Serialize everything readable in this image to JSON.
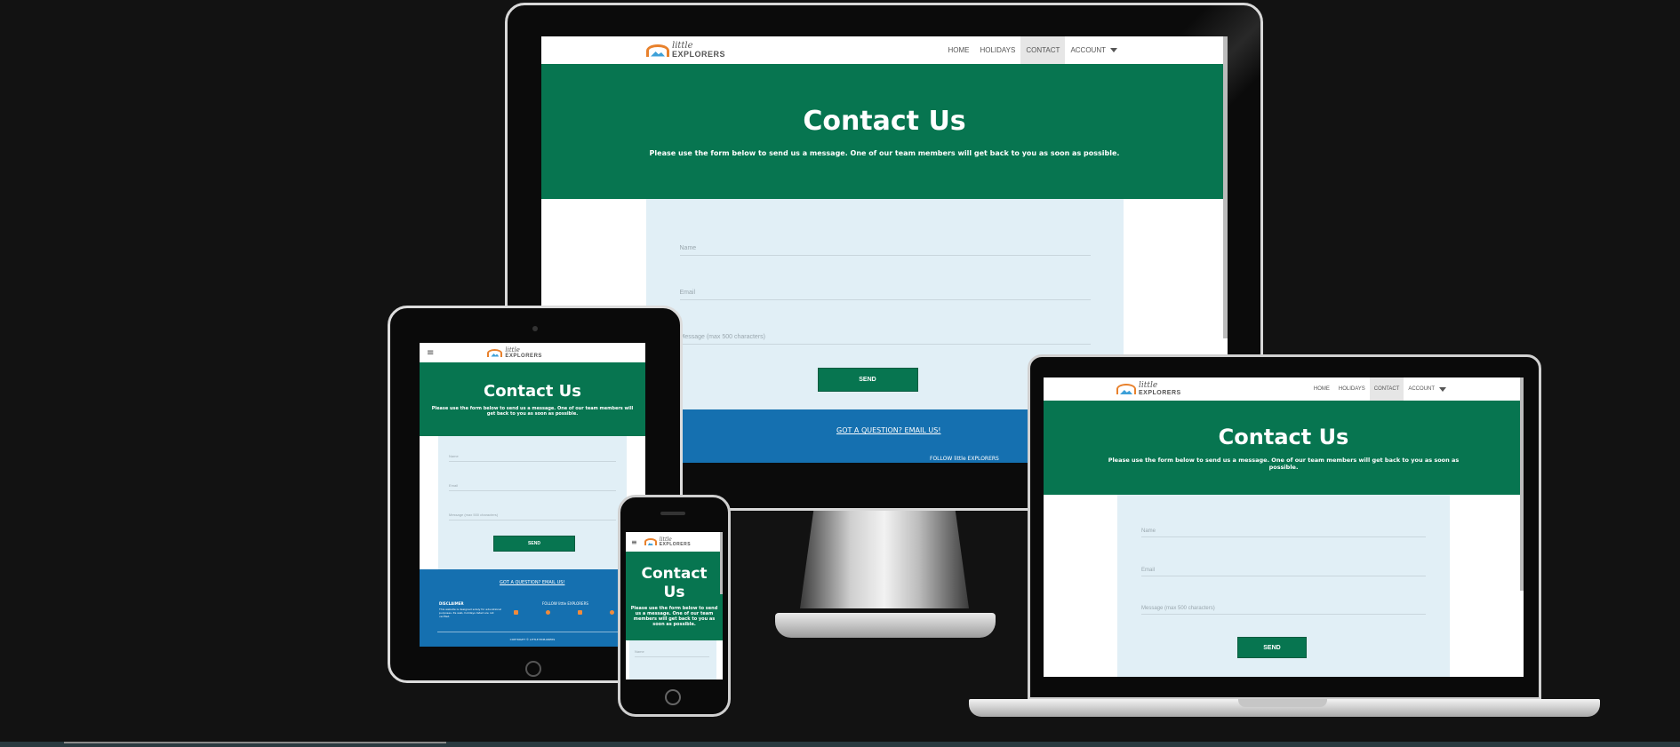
{
  "site": {
    "logo_top": "little",
    "logo_bottom": "EXPLORERS",
    "nav": {
      "home": "HOME",
      "holidays": "HOLIDAYS",
      "contact": "CONTACT",
      "account": "ACCOUNT"
    },
    "menu_glyph": "≡",
    "hero_title": "Contact Us",
    "hero_text": "Please use the form below to send us a message. One of our team members will get back to you as soon as possible.",
    "form": {
      "name_placeholder": "Name",
      "email_placeholder": "Email",
      "message_placeholder": "Message (max 500 characters)",
      "send_label": "SEND"
    },
    "footer": {
      "email_link": "GOT A QUESTION? EMAIL US!",
      "follow": "FOLLOW",
      "follow_brand": "little EXPLORERS",
      "disclaimer_title": "DISCLAIMER",
      "disclaimer_text": "This website is designed solely for educational purposes. Its web, holidays listed are not verified.",
      "copyright": "COPYRIGHT © LITTLE EXPLORERS"
    },
    "colors": {
      "brand_green": "#077550",
      "footer_blue": "#1570b0",
      "form_bg": "#e1eff6",
      "nav_active": "#e6e6e6"
    }
  }
}
